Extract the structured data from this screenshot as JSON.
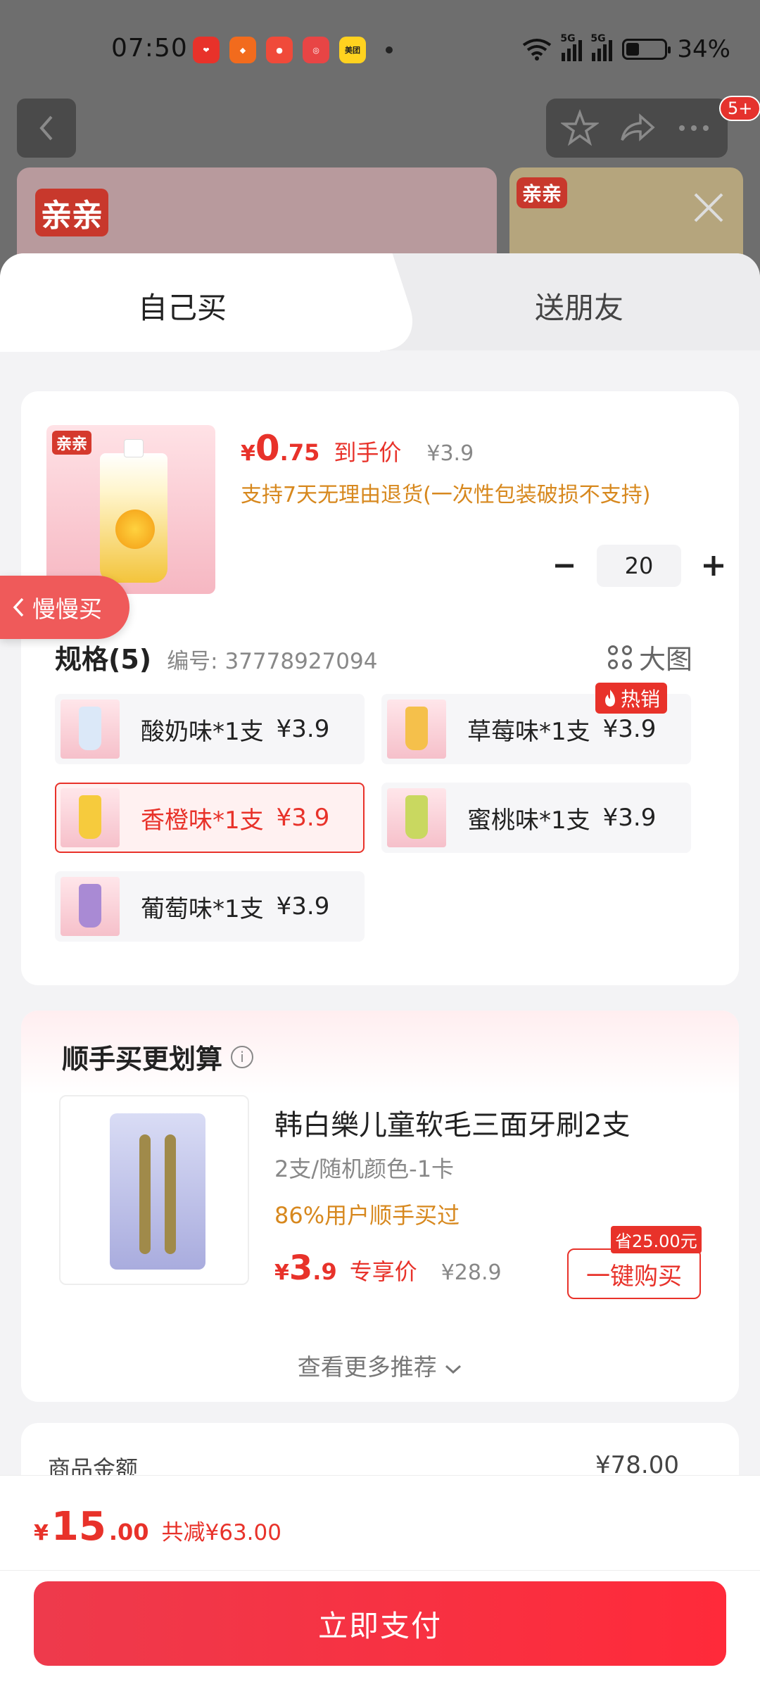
{
  "status_bar": {
    "time": "07:50",
    "app_icons": [
      "app-icon-1",
      "app-icon-2",
      "app-icon-3",
      "app-icon-4",
      "美团"
    ],
    "signal_1": "5G",
    "signal_2": "5G",
    "battery": "34%",
    "battery_level": 0.34
  },
  "background": {
    "badge": "5+",
    "logo_left": "亲亲",
    "logo_right": "亲亲"
  },
  "tabs": [
    {
      "label": "自己买"
    },
    {
      "label": "送朋友"
    }
  ],
  "product": {
    "price_symbol": "¥",
    "price_int": "0",
    "price_dec": ".75",
    "price_tag": "到手价",
    "orig_price": "¥3.9",
    "return_note": "支持7天无理由退货(一次性包装破损不支持)",
    "quantity": "20",
    "thumb_logo": "亲亲"
  },
  "spec": {
    "title": "规格(5)",
    "code": "编号: 37778927094",
    "big_image": "大图",
    "hot_label": "热销",
    "options": [
      {
        "label": "酸奶味*1支",
        "price": "¥3.9",
        "color": "#dbe8f8",
        "selected": false
      },
      {
        "label": "草莓味*1支",
        "price": "¥3.9",
        "color": "#f5c04b",
        "selected": false
      },
      {
        "label": "香橙味*1支",
        "price": "¥3.9",
        "color": "#f6cb3d",
        "selected": true
      },
      {
        "label": "蜜桃味*1支",
        "price": "¥3.9",
        "color": "#c9d860",
        "selected": false
      },
      {
        "label": "葡萄味*1支",
        "price": "¥3.9",
        "color": "#a98ad4",
        "selected": false
      }
    ]
  },
  "addon": {
    "title": "顺手买更划算",
    "info_icon": "i",
    "name": "韩白樂儿童软毛三面牙刷2支",
    "sub": "2支/随机颜色-1卡",
    "percent": "86%用户顺手买过",
    "price_symbol": "¥",
    "price_int": "3",
    "price_dec": ".9",
    "price_tag": "专享价",
    "orig_price": "¥28.9",
    "save_tag": "省25.00元",
    "buy_button": "一键购买",
    "more": "查看更多推荐"
  },
  "total": {
    "label": "商品金额",
    "value": "¥78.00"
  },
  "footer": {
    "price_symbol": "¥",
    "price_int": "15",
    "price_dec": ".00",
    "discount": "共减¥63.00",
    "pay_button": "立即支付"
  },
  "slow_buy": "慢慢买",
  "colors": {
    "accent": "#e8322a",
    "orange_text": "#d7881e",
    "pay_button": "#ff2a3a"
  }
}
